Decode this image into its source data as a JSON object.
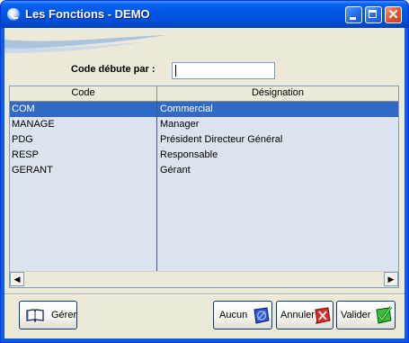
{
  "window": {
    "title": "Les Fonctions - DEMO"
  },
  "titlebar_buttons": {
    "minimize": "minimize-icon",
    "maximize": "maximize-icon",
    "close": "close-icon"
  },
  "search": {
    "label": "Code débute par :",
    "value": ""
  },
  "table": {
    "columns": [
      "Code",
      "Désignation"
    ],
    "rows": [
      {
        "code": "COM",
        "designation": "Commercial",
        "selected": true
      },
      {
        "code": "MANAGE",
        "designation": "Manager",
        "selected": false
      },
      {
        "code": "PDG",
        "designation": "Président Directeur Général",
        "selected": false
      },
      {
        "code": "RESP",
        "designation": "Responsable",
        "selected": false
      },
      {
        "code": "GERANT",
        "designation": "Gérant",
        "selected": false
      }
    ]
  },
  "buttons": {
    "manage": {
      "label": "Gérer",
      "icon": "book-icon"
    },
    "none": {
      "label": "Aucun",
      "icon": "no-selection-icon"
    },
    "cancel": {
      "label": "Annuler",
      "icon": "cancel-icon"
    },
    "validate": {
      "label": "Valider",
      "icon": "checkmark-icon"
    }
  },
  "colors": {
    "titlebar": "#0054e3",
    "selection": "#316ac5",
    "grid_bg": "#dbe4ee",
    "client_bg": "#ece9d8"
  }
}
